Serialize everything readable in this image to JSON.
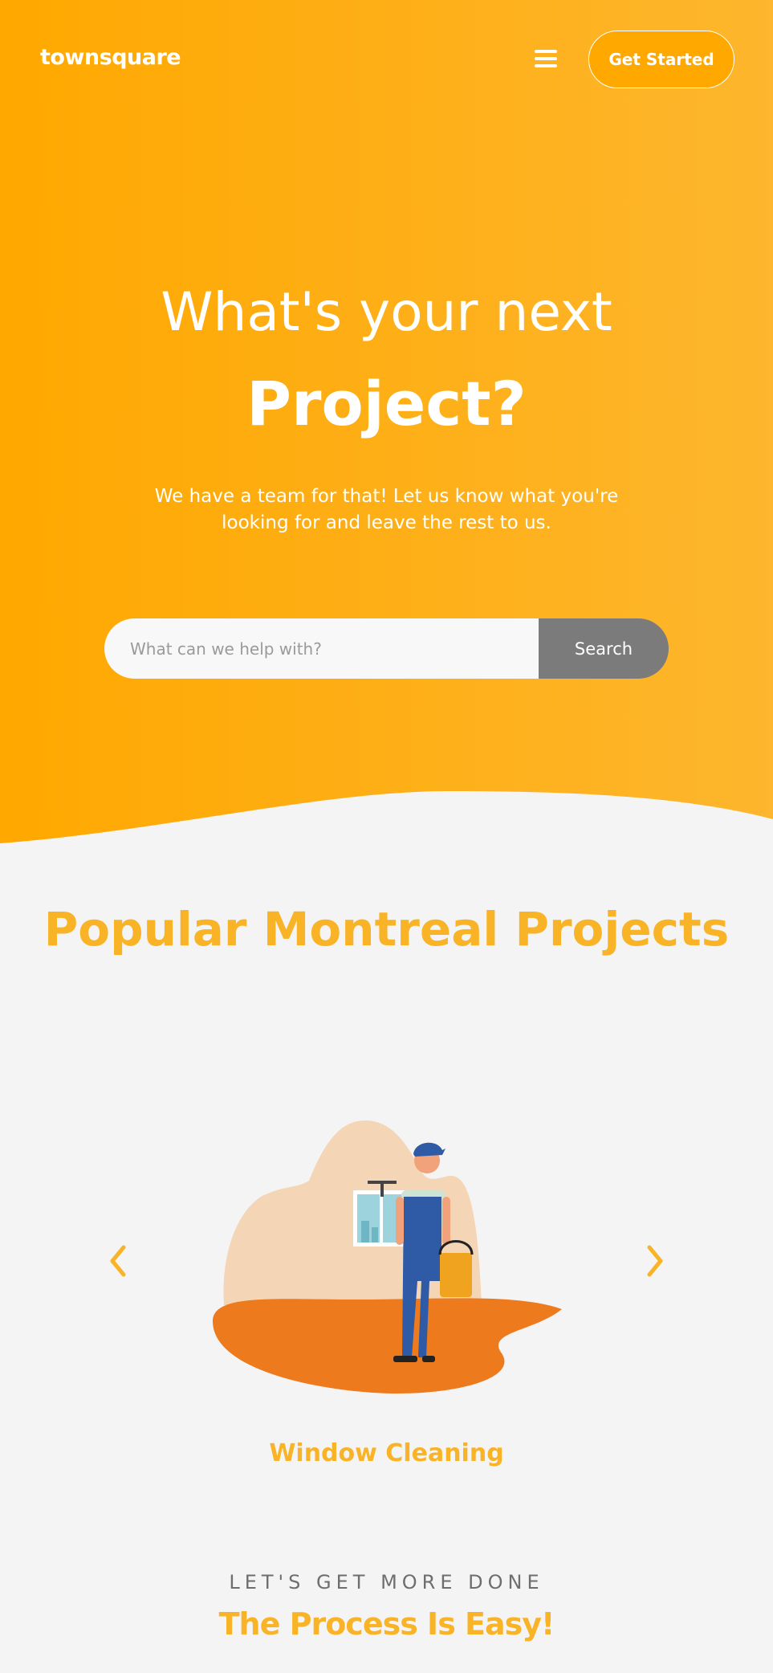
{
  "header": {
    "logo": "townsquare",
    "menu_icon": "hamburger-menu-icon",
    "cta_label": "Get Started"
  },
  "hero": {
    "title": "What's your next",
    "title_bold": "Project?",
    "subtitle": "We have a team for that! Let us know what you're looking for and leave the rest to us.",
    "search_placeholder": "What can we help with?",
    "search_button": "Search"
  },
  "popular": {
    "title": "Popular Montreal Projects",
    "prev_icon": "chevron-left-icon",
    "next_icon": "chevron-right-icon",
    "current_project": "Window Cleaning"
  },
  "process": {
    "kicker": "LET'S GET MORE DONE",
    "title": "The Process Is Easy!"
  },
  "colors": {
    "brand": "#ffa800",
    "accent": "#f9b327",
    "button_gray": "#7b7b7b"
  }
}
